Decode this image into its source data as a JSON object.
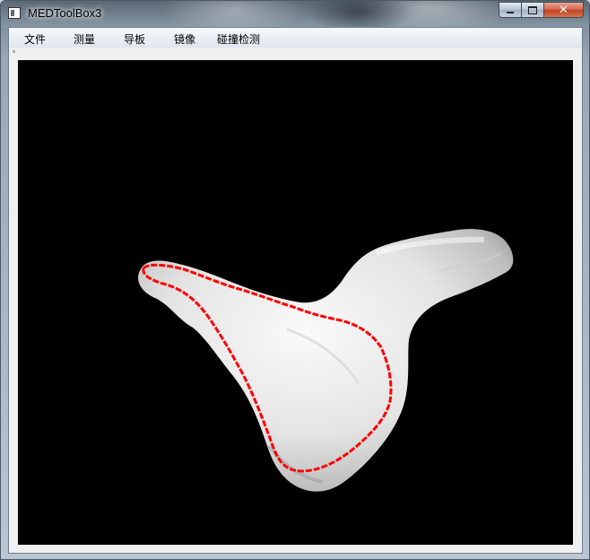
{
  "window": {
    "title": "MEDToolBox3",
    "caption_buttons": {
      "minimize": "minimize-icon",
      "maximize": "maximize-icon",
      "close": "close-icon"
    }
  },
  "menubar": {
    "items": [
      {
        "label": "文件"
      },
      {
        "label": "测量"
      },
      {
        "label": "导板"
      },
      {
        "label": "镜像"
      },
      {
        "label": "碰撞检测"
      }
    ]
  },
  "viewport": {
    "background": "#000000",
    "model_color": "#ececec",
    "contour_color": "#ff0000"
  }
}
